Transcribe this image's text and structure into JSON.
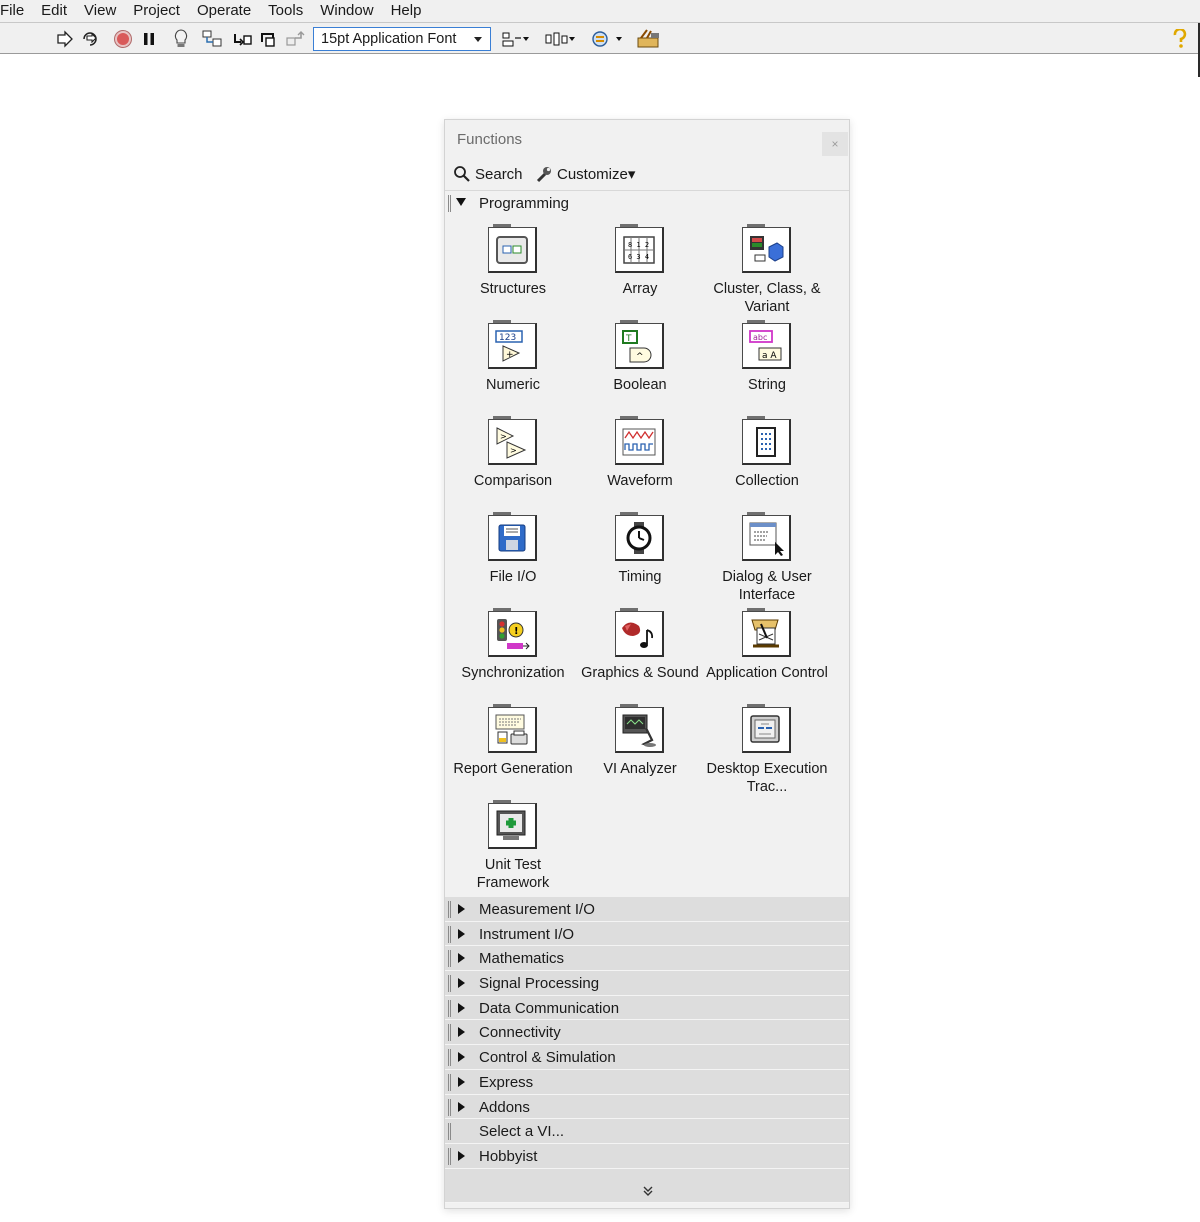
{
  "menubar": {
    "items": [
      "File",
      "Edit",
      "View",
      "Project",
      "Operate",
      "Tools",
      "Window",
      "Help"
    ]
  },
  "toolbar": {
    "font_select_value": "15pt Application Font",
    "icons": [
      "run-arrow-icon",
      "run-continuously-icon",
      "abort-icon",
      "pause-icon",
      "highlight-execution-icon",
      "retain-wire-values-icon",
      "step-into-icon",
      "step-over-icon",
      "step-out-icon",
      "align-objects-icon",
      "distribute-objects-icon",
      "reorder-icon",
      "clean-up-diagram-icon",
      "context-help-icon"
    ]
  },
  "palette": {
    "title": "Functions",
    "close_label": "×",
    "search_label": "Search",
    "customize_label": "Customize▾",
    "open_section": "Programming",
    "items": [
      {
        "label": "Structures",
        "icon": "structures-icon"
      },
      {
        "label": "Array",
        "icon": "array-icon"
      },
      {
        "label": "Cluster, Class, & Variant",
        "icon": "cluster-class-variant-icon"
      },
      {
        "label": "Numeric",
        "icon": "numeric-icon"
      },
      {
        "label": "Boolean",
        "icon": "boolean-icon"
      },
      {
        "label": "String",
        "icon": "string-icon"
      },
      {
        "label": "Comparison",
        "icon": "comparison-icon"
      },
      {
        "label": "Waveform",
        "icon": "waveform-icon"
      },
      {
        "label": "Collection",
        "icon": "collection-icon"
      },
      {
        "label": "File I/O",
        "icon": "file-io-icon"
      },
      {
        "label": "Timing",
        "icon": "timing-icon"
      },
      {
        "label": "Dialog & User Interface",
        "icon": "dialog-ui-icon"
      },
      {
        "label": "Synchronization",
        "icon": "synchronization-icon"
      },
      {
        "label": "Graphics & Sound",
        "icon": "graphics-sound-icon"
      },
      {
        "label": "Application Control",
        "icon": "application-control-icon"
      },
      {
        "label": "Report Generation",
        "icon": "report-generation-icon"
      },
      {
        "label": "VI Analyzer",
        "icon": "vi-analyzer-icon"
      },
      {
        "label": "Desktop Execution Trac...",
        "icon": "desktop-execution-trace-icon"
      },
      {
        "label": "Unit Test Framework",
        "icon": "unit-test-framework-icon"
      }
    ],
    "collapsed_sections": [
      {
        "label": "Measurement I/O",
        "expandable": true
      },
      {
        "label": "Instrument I/O",
        "expandable": true
      },
      {
        "label": "Mathematics",
        "expandable": true
      },
      {
        "label": "Signal Processing",
        "expandable": true
      },
      {
        "label": "Data Communication",
        "expandable": true
      },
      {
        "label": "Connectivity",
        "expandable": true
      },
      {
        "label": "Control & Simulation",
        "expandable": true
      },
      {
        "label": "Express",
        "expandable": true
      },
      {
        "label": "Addons",
        "expandable": true
      },
      {
        "label": "Select a VI...",
        "expandable": false
      },
      {
        "label": "Hobbyist",
        "expandable": true
      }
    ],
    "more_label": "≫"
  }
}
